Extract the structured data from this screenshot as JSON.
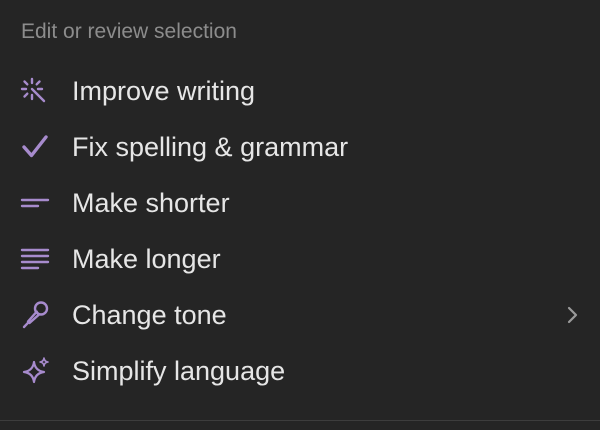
{
  "menu": {
    "section_title": "Edit or review selection",
    "accent_color": "#a78bcd",
    "items": [
      {
        "label": "Improve writing",
        "icon": "magic-wand-icon"
      },
      {
        "label": "Fix spelling & grammar",
        "icon": "checkmark-icon"
      },
      {
        "label": "Make shorter",
        "icon": "short-lines-icon"
      },
      {
        "label": "Make longer",
        "icon": "long-lines-icon"
      },
      {
        "label": "Change tone",
        "icon": "microphone-icon",
        "has_submenu": true
      },
      {
        "label": "Simplify language",
        "icon": "sparkles-icon"
      }
    ]
  }
}
